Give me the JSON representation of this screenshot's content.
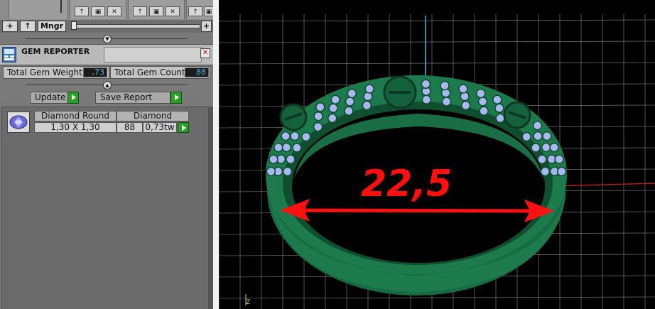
{
  "toolbar": {
    "add_label": "+",
    "up_label": "↑",
    "manager_label": "Mngr",
    "zoom_plus_label": "+"
  },
  "mini_buttons": [
    "↑",
    "▣",
    "✕"
  ],
  "gem_reporter": {
    "title": "GEM REPORTER",
    "total_weight_label": "Total Gem Weight",
    "total_weight_value": ",73",
    "total_count_label": "Total Gem Count",
    "total_count_value": "88",
    "update_label": "Update",
    "save_report_label": "Save Report",
    "table": {
      "headers": [
        "Diamond Round",
        "Diamond"
      ],
      "rows": [
        {
          "size": "1,30 X 1,30",
          "count": "88",
          "weight": "0,73tw"
        }
      ]
    }
  },
  "viewport": {
    "dimension_annotation": "22,5",
    "axis_label": "Z",
    "colors": {
      "background": "#000000",
      "grid": "#8a8a8a",
      "ring": "#1f6b47",
      "annotation": "#ff1010",
      "gem": "#a9b8f0",
      "axis_y": "#2e8fb5",
      "axis_x": "#b02020"
    }
  },
  "icons": [
    "gem-reporter-icon",
    "close-icon",
    "play-icon",
    "diamond-round-icon",
    "collapse-icon"
  ]
}
